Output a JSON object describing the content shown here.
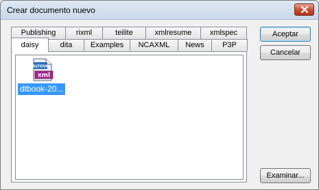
{
  "window": {
    "title": "Crear documento nuevo"
  },
  "tabs": {
    "back_row": [
      "Publishing",
      "rixml",
      "teilite",
      "xmlresume",
      "xmlspec"
    ],
    "front_row": [
      "daisy",
      "dita",
      "Examples",
      "NCAXML",
      "News",
      "P3P"
    ],
    "active": "daisy"
  },
  "files": [
    {
      "label": "dtbook-20...",
      "icon": "altova-xml-file-icon",
      "icon_text_top": "ALTOVA",
      "icon_text": "xml",
      "selected": true
    }
  ],
  "buttons": {
    "accept": "Aceptar",
    "cancel": "Cancelar",
    "browse": "Examinar..."
  },
  "colors": {
    "selection": "#3399ff",
    "close_button": "#c75238"
  }
}
